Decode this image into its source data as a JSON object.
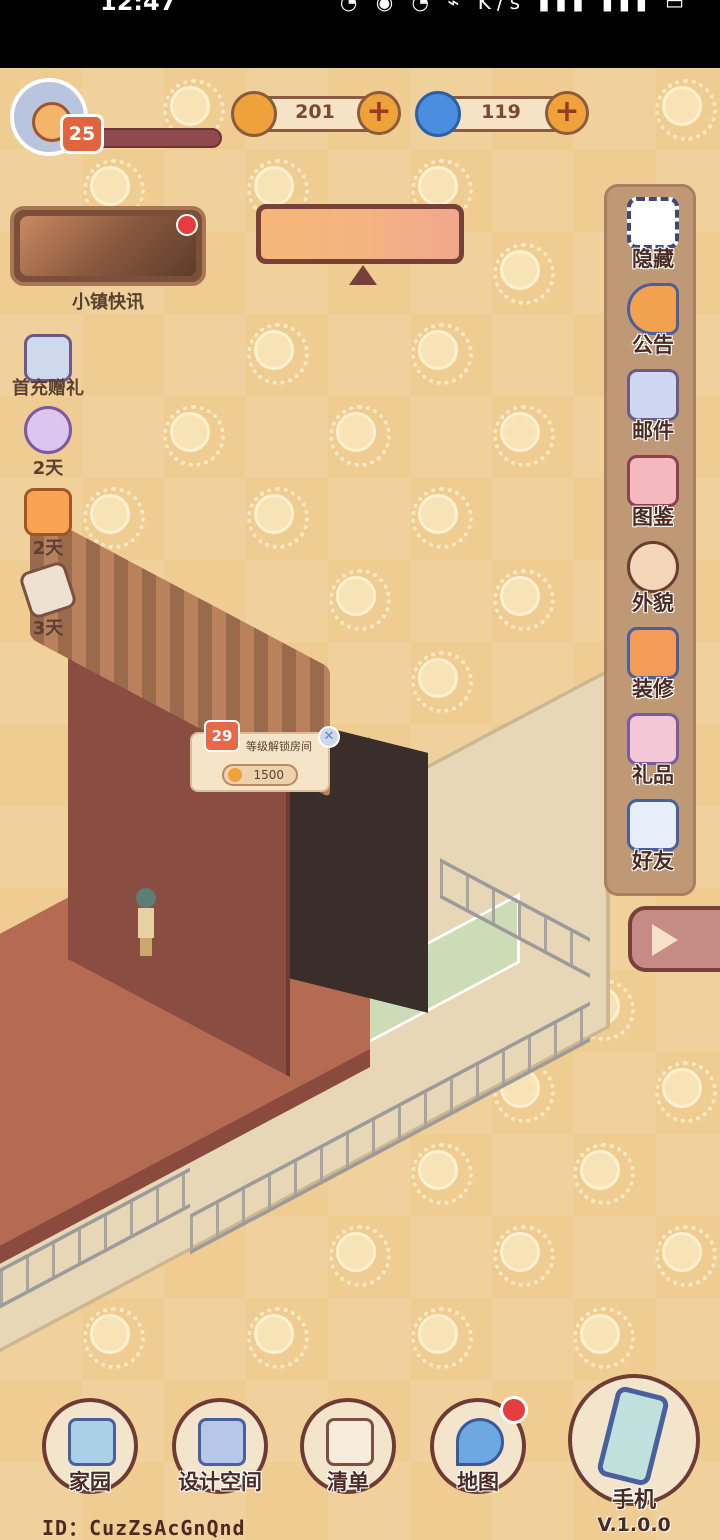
{
  "status_bar": {
    "time": "12:47",
    "icons": "◔ ◉ ◔ ⌁ K/s ▮▮▮ ▮▮▮ ▭"
  },
  "player": {
    "level": "25"
  },
  "currencies": [
    {
      "name": "coin",
      "value": "201",
      "color": "#f0a23a"
    },
    {
      "name": "swirl",
      "value": "119",
      "color": "#4a8ee0"
    }
  ],
  "news": {
    "label": "小镇快讯"
  },
  "left_menu": [
    {
      "label": "首充赠礼",
      "icon": "gift-letter-icon"
    },
    {
      "label": "2天",
      "icon": "question-mark-icon"
    },
    {
      "label": "2天",
      "icon": "cat-jar-icon"
    },
    {
      "label": "3天",
      "icon": "sealed-letter-icon"
    }
  ],
  "right_menu": [
    {
      "label": "隐藏",
      "icon": "hide-frame-icon"
    },
    {
      "label": "公告",
      "icon": "megaphone-icon"
    },
    {
      "label": "邮件",
      "icon": "mail-icon"
    },
    {
      "label": "图鉴",
      "icon": "book-icon"
    },
    {
      "label": "外貌",
      "icon": "face-icon"
    },
    {
      "label": "装修",
      "icon": "renovate-icon"
    },
    {
      "label": "礼品",
      "icon": "gift-box-icon"
    },
    {
      "label": "好友",
      "icon": "friends-icon"
    }
  ],
  "unlock_popup": {
    "level": "29",
    "text": "等级解锁房间",
    "cost": "1500"
  },
  "bottom_nav": [
    {
      "label": "家园",
      "icon": "home-icon"
    },
    {
      "label": "设计空间",
      "icon": "design-ruler-icon"
    },
    {
      "label": "清单",
      "icon": "list-icon"
    },
    {
      "label": "地图",
      "icon": "map-pin-icon"
    }
  ],
  "phone": {
    "label": "手机",
    "version": "V.1.0.0"
  },
  "user_id": "ID：CuzZsAcGnQnd",
  "colors": {
    "accent": "#e8694a",
    "panel": "#bf9876",
    "background": "#efcd92"
  }
}
